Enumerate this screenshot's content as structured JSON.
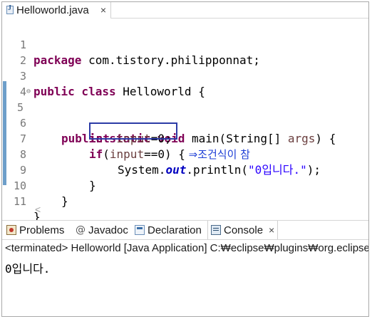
{
  "editor": {
    "tab_label": "Helloworld.java",
    "tab_close": "×",
    "lines": [
      {
        "num": "1"
      },
      {
        "num": "2"
      },
      {
        "num": "3"
      },
      {
        "num": "4"
      },
      {
        "num": "5"
      },
      {
        "num": "6"
      },
      {
        "num": "7"
      },
      {
        "num": "8"
      },
      {
        "num": "9"
      },
      {
        "num": "10"
      },
      {
        "num": "11"
      }
    ],
    "fold_marker": "⊖",
    "code": {
      "l1_kw": "package",
      "l1_rest": " com.tistory.philipponnat;",
      "l3_kw": "public class",
      "l3_rest": " Helloworld {",
      "l5_kw": "public static void",
      "l5_mid": " main(String[] ",
      "l5_var": "args",
      "l5_end": ") {",
      "l6_kw": "int",
      "l6_sp": " ",
      "l6_var": "input",
      "l6_end": "=0;",
      "l7_kw": "if",
      "l7_open": "(",
      "l7_var": "input",
      "l7_end": "==0)",
      "l7_brace": " {",
      "l7_annotation": " ⇒조건식이 참",
      "l8_pre": "System.",
      "l8_field": "out",
      "l8_mid": ".println(",
      "l8_str": "\"0입니다.\"",
      "l8_end": ");",
      "l9": "}",
      "l10": "}",
      "l11": "}"
    },
    "scroll_left": "<"
  },
  "views": {
    "tabs": {
      "problems": "Problems",
      "javadoc": "Javadoc",
      "declaration": "Declaration",
      "console": "Console"
    },
    "javadoc_icon": "@",
    "console_close": "×"
  },
  "console": {
    "status": "<terminated> Helloworld [Java Application] C:₩eclipse₩plugins₩org.eclipse",
    "output": "0입니다."
  },
  "colors": {
    "keyword": "#7f0055",
    "string": "#2a00ff",
    "local_var": "#6a3e3e",
    "field": "#0000c0",
    "annotation": "#1e3fd6",
    "highlight_box": "#2c3ba6"
  }
}
